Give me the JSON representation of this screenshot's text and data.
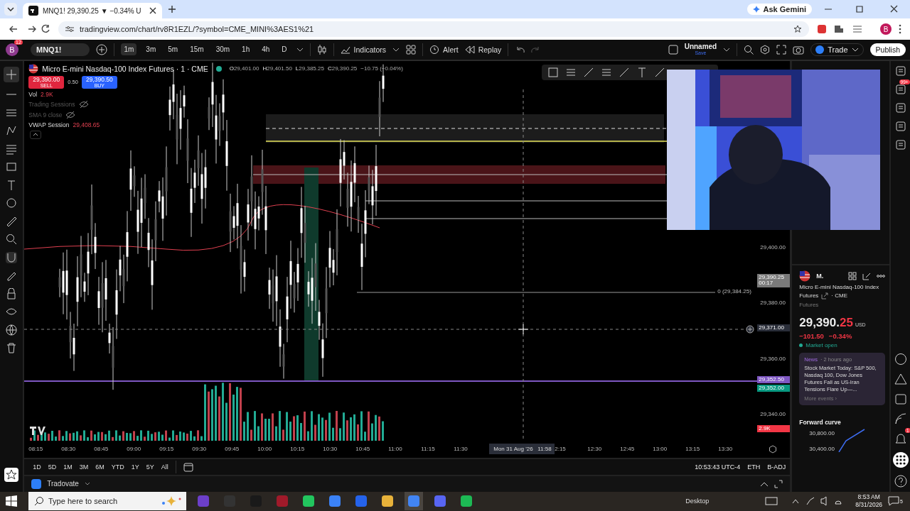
{
  "browser": {
    "tab_title": "MNQ1! 29,390.25 ▼ −0.34% U",
    "gemini": "Ask Gemini",
    "url": "tradingview.com/chart/rv8R1EZL/?symbol=CME_MINI%3AES1%21",
    "profile": "B"
  },
  "toolbar": {
    "avatar": "B",
    "notification_count": "12",
    "symbol": "MNQ1!",
    "intervals": [
      {
        "label": "1m",
        "selected": true
      },
      {
        "label": "3m",
        "selected": false
      },
      {
        "label": "5m",
        "selected": false
      },
      {
        "label": "15m",
        "selected": false
      },
      {
        "label": "30m",
        "selected": false
      },
      {
        "label": "1h",
        "selected": false
      },
      {
        "label": "4h",
        "selected": false
      },
      {
        "label": "D",
        "selected": false
      }
    ],
    "indicators": "Indicators",
    "alert": "Alert",
    "replay": "Replay",
    "layout_name": "Unnamed",
    "layout_status": "Save",
    "trade": "Trade",
    "publish": "Publish"
  },
  "legend": {
    "title": "Micro E-mini Nasdaq-100 Index Futures · 1 · CME",
    "ohlc": [
      {
        "key": "O",
        "value": "29,401.00"
      },
      {
        "key": "H",
        "value": "29,401.50"
      },
      {
        "key": "L",
        "value": "29,385.25"
      },
      {
        "key": "C",
        "value": "29,390.25"
      }
    ],
    "change": "−10.75 (−0.04%)",
    "sell": {
      "price": "29,390.00",
      "label": "SELL"
    },
    "spread": "0.50",
    "buy": {
      "price": "29,390.50",
      "label": "BUY"
    },
    "indicators": [
      {
        "name": "Vol",
        "value": "2.9K",
        "hidden": false
      },
      {
        "name": "Trading Sessions",
        "hidden": true
      },
      {
        "name": "SMA 9 close",
        "hidden": true
      },
      {
        "name": "VWAP Session",
        "value": "29,408.65",
        "hidden": false
      }
    ]
  },
  "price_axis": [
    "29,400.00",
    "29,380.00",
    "29,360.00",
    "29,340.00"
  ],
  "price_tags": [
    {
      "text": "29,390.25",
      "sub": "00:17",
      "color": "#7a7a7a"
    },
    {
      "text": "29,371.00",
      "color": "#2a2e39"
    },
    {
      "text": "29,352.50",
      "color": "#7e57c2"
    },
    {
      "text": "29,352.00",
      "color": "#089981"
    },
    {
      "text": "2.9K",
      "color": "#f23645"
    }
  ],
  "position_label": "0 (29,384.25)",
  "time_axis_left": [
    "08:15",
    "08:30",
    "08:45",
    "09:00",
    "09:15",
    "09:30",
    "09:45",
    "10:00",
    "10:15",
    "10:30",
    "10:45",
    "11:00",
    "11:15",
    "11:30"
  ],
  "crosshair_time": "Mon 31 Aug '26   11:58",
  "time_axis_right": [
    "2:15",
    "12:30",
    "12:45",
    "13:00",
    "13:15",
    "13:30"
  ],
  "ranges": [
    "1D",
    "5D",
    "1M",
    "3M",
    "6M",
    "YTD",
    "1Y",
    "5Y",
    "All"
  ],
  "clock": "10:53:43 UTC-4",
  "session": "ETH",
  "adjust": "B-ADJ",
  "broker": "Tradovate",
  "details": {
    "symbol": "M.",
    "name": "Micro E-mini Nasdaq-100 Index",
    "name_2": "Futures",
    "exchange": "· CME",
    "type": "Futures",
    "price_main": "29,390.",
    "price_frac": "25",
    "currency": "USD",
    "change": "−101.50",
    "change_pct": "−0.34%",
    "status": "Market open",
    "news": {
      "source": "News",
      "time": "· 2 hours ago",
      "headline": "Stock Market Today: S&P 500, Nasdaq 100, Dow Jones Futures Fall as US-Iran Tensions Flare Up—...",
      "more": "More events ›"
    },
    "forward_curve": "Forward curve",
    "curve_ticks": [
      "30,800.00",
      "30,400.00"
    ]
  },
  "side_badges": [
    "99+",
    "1"
  ],
  "taskbar": {
    "search_placeholder": "Type here to search",
    "desktop": "Desktop",
    "time": "8:53 AM",
    "date": "8/31/2026",
    "notifications": "5"
  }
}
